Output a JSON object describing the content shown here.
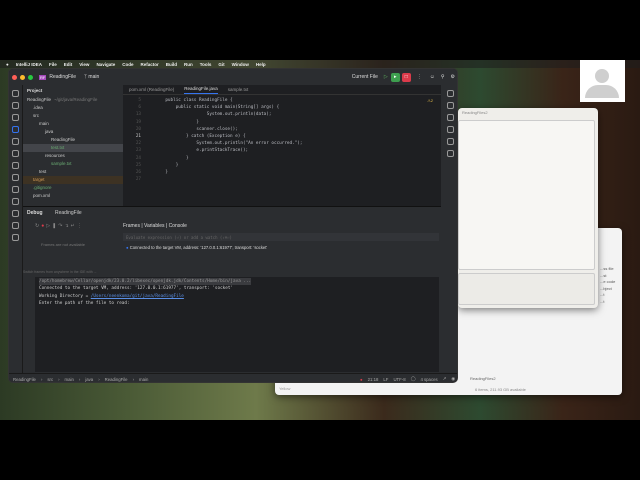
{
  "menubar": {
    "app": "IntelliJ IDEA",
    "items": [
      "File",
      "Edit",
      "View",
      "Navigate",
      "Code",
      "Refactor",
      "Build",
      "Run",
      "Tools",
      "Git",
      "Window",
      "Help"
    ]
  },
  "titlebar": {
    "project": "ReadingFile",
    "branch": "main",
    "run_config": "Current File"
  },
  "project_panel": {
    "title": "Project",
    "items": [
      {
        "label": "ReadingFile",
        "hint": "~/git/java/ReadingFile",
        "indent": 0
      },
      {
        "label": ".idea",
        "indent": 1
      },
      {
        "label": "src",
        "indent": 1
      },
      {
        "label": "main",
        "indent": 2
      },
      {
        "label": "java",
        "indent": 3
      },
      {
        "label": "ReadingFile",
        "indent": 4
      },
      {
        "label": "test.txt",
        "indent": 4,
        "selected": true
      },
      {
        "label": "resources",
        "indent": 3
      },
      {
        "label": "sample.txt",
        "indent": 4
      },
      {
        "label": "test",
        "indent": 2
      },
      {
        "label": "target",
        "indent": 1
      },
      {
        "label": ".gitignore",
        "indent": 1
      },
      {
        "label": "pom.xml",
        "indent": 1
      }
    ]
  },
  "editor": {
    "tabs": [
      "pom.xml (ReadingFile)",
      "ReadingFile.java",
      "sample.txt"
    ],
    "active_tab": 1,
    "warnings": "⚠2",
    "lines": [
      {
        "n": "5",
        "code": "    public class ReadingFile {"
      },
      {
        "n": "6",
        "code": "        public static void main(String[] args) {"
      },
      {
        "n": "13",
        "code": "                    System.out.println(data);"
      },
      {
        "n": "19",
        "code": "                }"
      },
      {
        "n": "20",
        "code": "                scanner.close();"
      },
      {
        "n": "21",
        "code": "            } catch (Exception e) {"
      },
      {
        "n": "22",
        "code": "                System.out.println(\"An error occurred.\");"
      },
      {
        "n": "23",
        "code": "                e.printStackTrace();"
      },
      {
        "n": "24",
        "code": "            }"
      },
      {
        "n": "25",
        "code": "        }"
      },
      {
        "n": "26",
        "code": "    }"
      },
      {
        "n": "27",
        "code": ""
      }
    ]
  },
  "debug": {
    "tab_debug": "Debug",
    "tab_session": "ReadingFile",
    "frames_empty": "Frames are not available",
    "switch_hint": "Switch frames from anywhere in the IDE with ...",
    "subtabs": "Frames | Variables | Console",
    "eval_placeholder": "Evaluate expression (⏎) or add a watch (⇧⌘⏎)",
    "connected_msg": "Connected to the target VM, address: '127.0.0.1:61977', transport: 'socket'",
    "console": [
      "/opt/homebrew/Cellar/openjdk/23.0.2/libexec/openjdk.jdk/Contents/Home/bin/java ...",
      "Connected to the target VM, address: '127.0.0.1:61977', transport: 'socket'",
      "Working Directory = ",
      "Enter the path of the file to read:"
    ],
    "working_dir": "/Users/neenkoma/git/java/ReadingFile"
  },
  "statusbar": {
    "breadcrumbs": [
      "ReadingFile",
      "src",
      "main",
      "java",
      "ReadingFile",
      "main"
    ],
    "position": "21:18",
    "line_sep": "LF",
    "encoding": "UTF-8",
    "indent": "4 spaces"
  },
  "textedit": {
    "title": "ReadingFiles2"
  },
  "finder": {
    "path": "ReadingFiles2",
    "status": "6 items, 211.93 GB available",
    "sidebar": "Yellow",
    "items": [
      "...ss file",
      "...st",
      "...e code",
      "...bject",
      "...t",
      "...t"
    ]
  },
  "colors": {
    "accent": "#3574f0",
    "green": "#3e9e4f",
    "red": "#db3b4b"
  }
}
